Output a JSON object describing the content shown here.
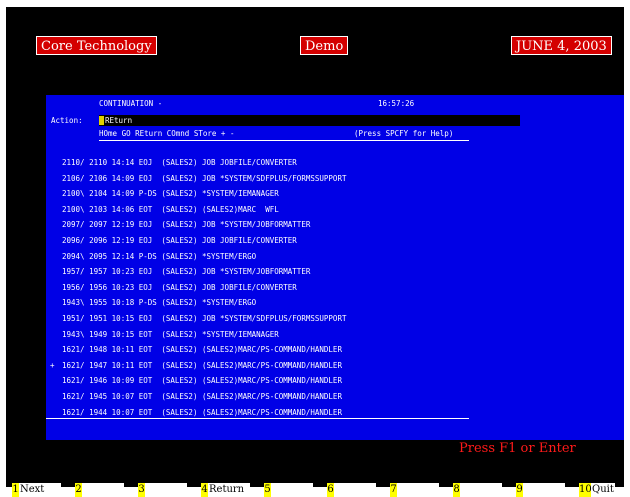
{
  "header": {
    "app_title": "Core Technology",
    "mode": "Demo",
    "date": "JUNE 4, 2003"
  },
  "screen": {
    "title": "CONTINUATION -",
    "time": "16:57:26",
    "action_label": "Action:",
    "action_value": "REturn",
    "commands": "HOme GO REturn COmnd STore + -",
    "help_hint": "(Press SPCFY for Help)",
    "rows": [
      {
        "marker": " ",
        "text": "2110/ 2110 14:14 EOJ  (SALES2) JOB JOBFILE/CONVERTER"
      },
      {
        "marker": " ",
        "text": "2106/ 2106 14:09 EOJ  (SALES2) JOB *SYSTEM/SDFPLUS/FORMSSUPPORT"
      },
      {
        "marker": " ",
        "text": "2100\\ 2104 14:09 P-DS (SALES2) *SYSTEM/IEMANAGER"
      },
      {
        "marker": " ",
        "text": "2100\\ 2103 14:06 EOT  (SALES2) (SALES2)MARC  WFL"
      },
      {
        "marker": " ",
        "text": "2097/ 2097 12:19 EOJ  (SALES2) JOB *SYSTEM/JOBFORMATTER"
      },
      {
        "marker": " ",
        "text": "2096/ 2096 12:19 EOJ  (SALES2) JOB JOBFILE/CONVERTER"
      },
      {
        "marker": " ",
        "text": "2094\\ 2095 12:14 P-DS (SALES2) *SYSTEM/ERGO"
      },
      {
        "marker": " ",
        "text": "1957/ 1957 10:23 EOJ  (SALES2) JOB *SYSTEM/JOBFORMATTER"
      },
      {
        "marker": " ",
        "text": "1956/ 1956 10:23 EOJ  (SALES2) JOB JOBFILE/CONVERTER"
      },
      {
        "marker": " ",
        "text": "1943\\ 1955 10:18 P-DS (SALES2) *SYSTEM/ERGO"
      },
      {
        "marker": " ",
        "text": "1951/ 1951 10:15 EOJ  (SALES2) JOB *SYSTEM/SDFPLUS/FORMSSUPPORT"
      },
      {
        "marker": " ",
        "text": "1943\\ 1949 10:15 EOT  (SALES2) *SYSTEM/IEMANAGER"
      },
      {
        "marker": " ",
        "text": "1621/ 1948 10:11 EOT  (SALES2) (SALES2)MARC/PS-COMMAND/HANDLER"
      },
      {
        "marker": "+",
        "text": "1621/ 1947 10:11 EOT  (SALES2) (SALES2)MARC/PS-COMMAND/HANDLER"
      },
      {
        "marker": " ",
        "text": "1621/ 1946 10:09 EOT  (SALES2) (SALES2)MARC/PS-COMMAND/HANDLER"
      },
      {
        "marker": " ",
        "text": "1621/ 1945 10:07 EOT  (SALES2) (SALES2)MARC/PS-COMMAND/HANDLER"
      },
      {
        "marker": " ",
        "text": "1621/ 1944 10:07 EOT  (SALES2) (SALES2)MARC/PS-COMMAND/HANDLER"
      }
    ]
  },
  "prompt": "Press F1 or Enter",
  "function_keys": [
    {
      "num": "1",
      "label": "Next"
    },
    {
      "num": "2",
      "label": ""
    },
    {
      "num": "3",
      "label": ""
    },
    {
      "num": "4",
      "label": "Return"
    },
    {
      "num": "5",
      "label": ""
    },
    {
      "num": "6",
      "label": ""
    },
    {
      "num": "7",
      "label": ""
    },
    {
      "num": "8",
      "label": ""
    },
    {
      "num": "9",
      "label": ""
    },
    {
      "num": "10",
      "label": "Quit"
    }
  ],
  "colors": {
    "screen_bg": "#0000e6",
    "title_button_bg": "#d40000",
    "prompt_text": "#ff1a1a",
    "fkey_number_bg": "#ffff00"
  }
}
